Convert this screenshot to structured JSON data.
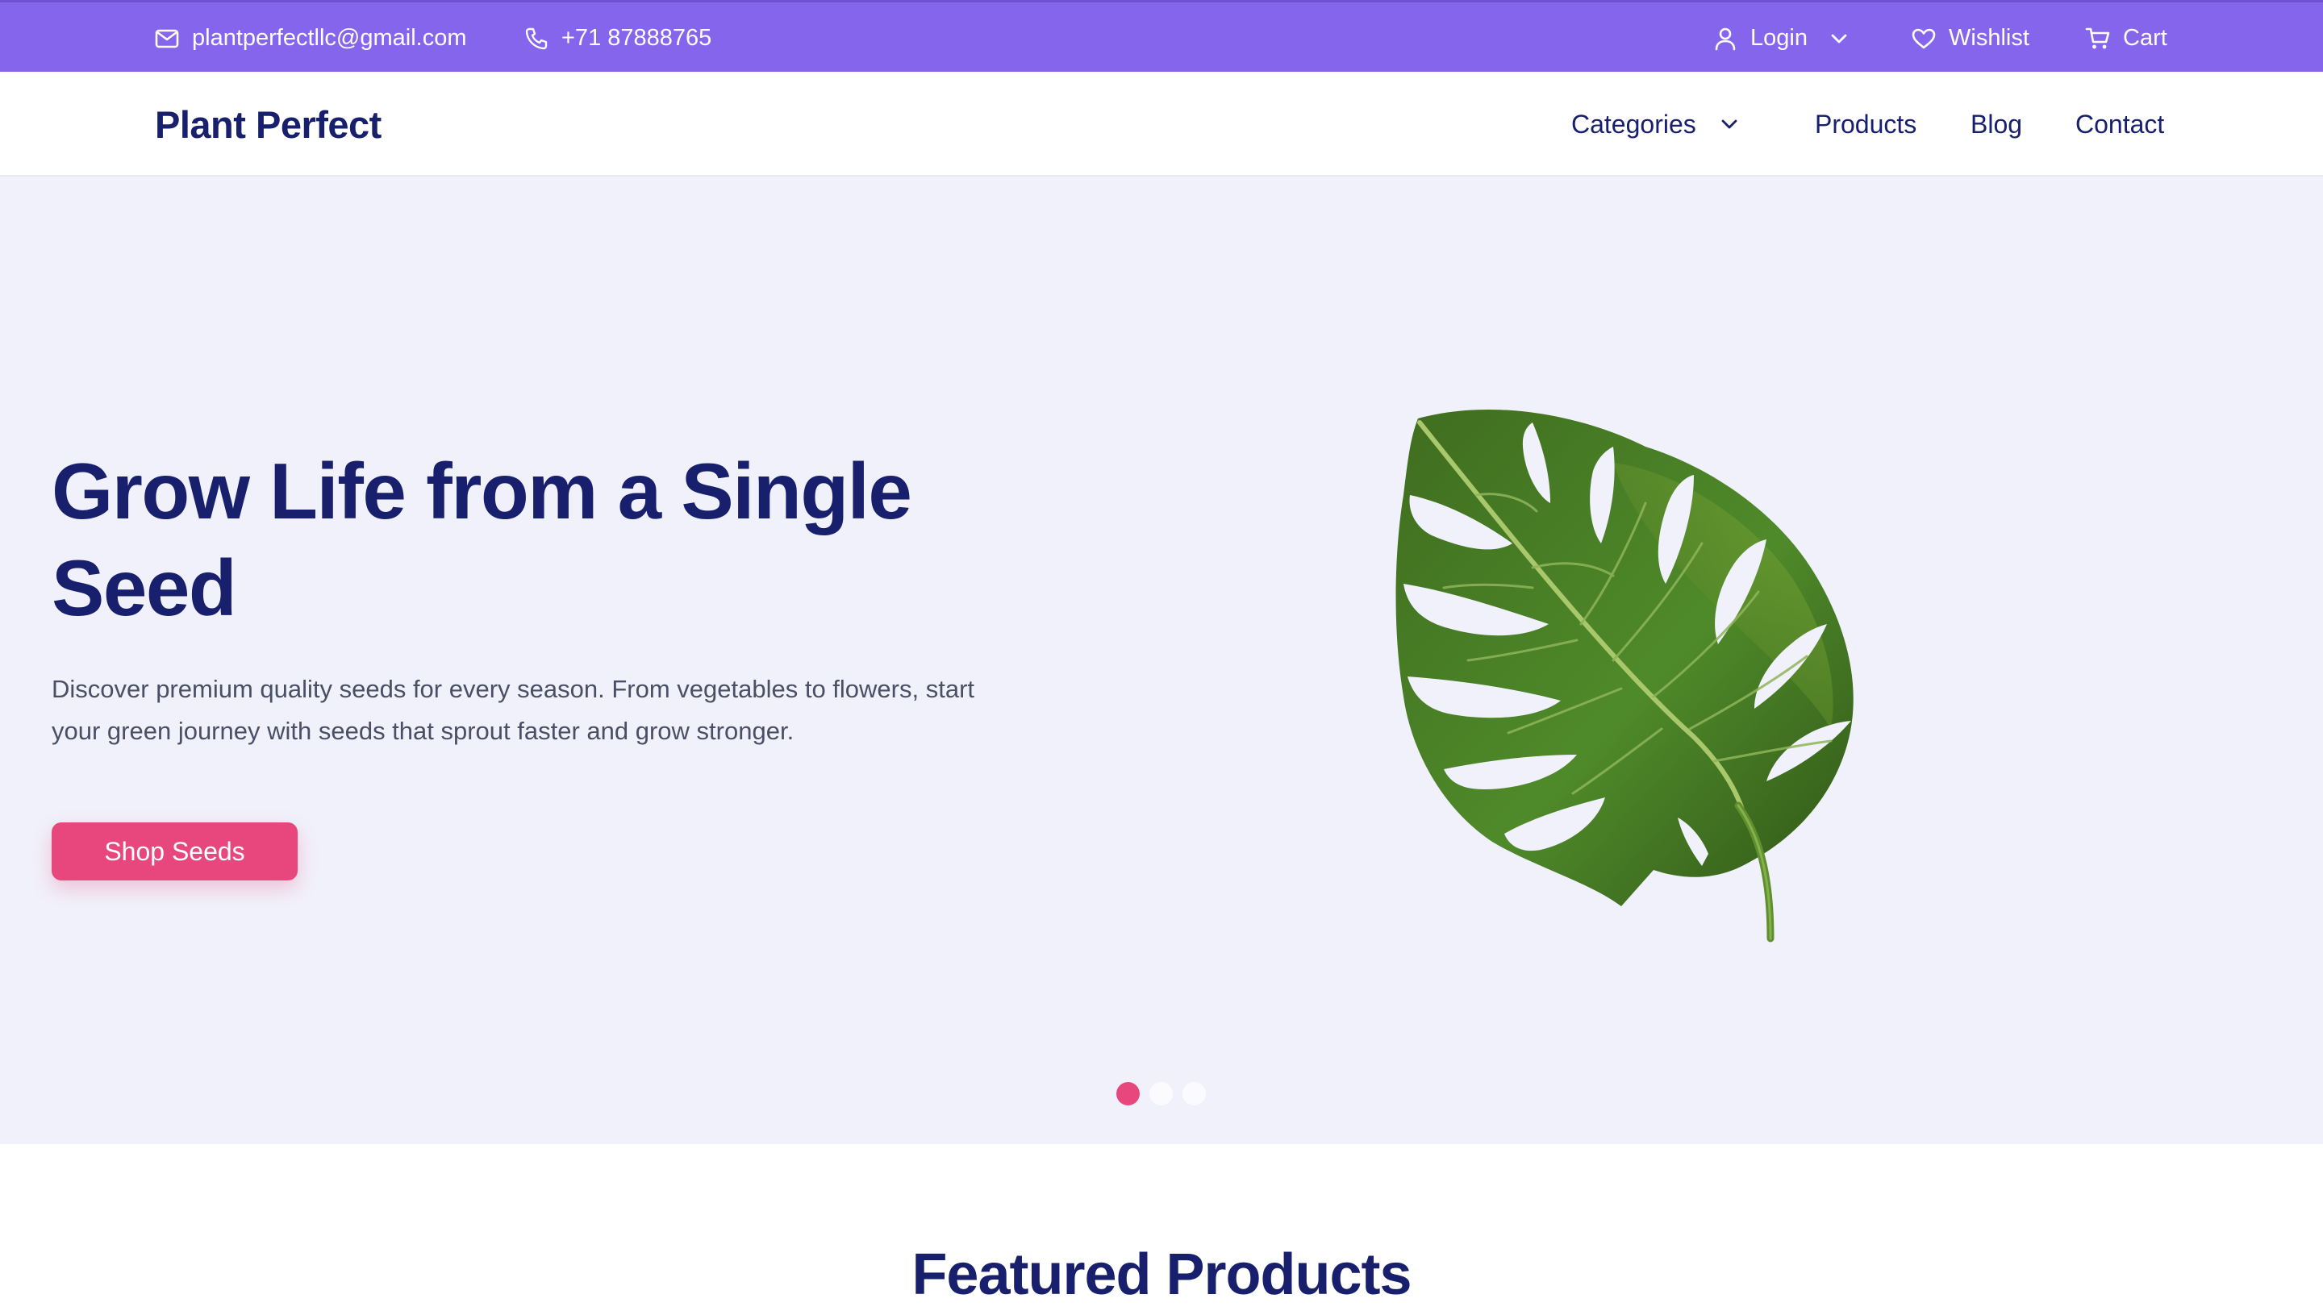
{
  "topbar": {
    "email": "plantperfectllc@gmail.com",
    "phone": "+71 87888765",
    "login_label": "Login",
    "wishlist_label": "Wishlist",
    "cart_label": "Cart",
    "icons": {
      "email": "mail-icon",
      "phone": "phone-icon",
      "login": "user-icon",
      "login_dropdown": "chevron-down-icon",
      "wishlist": "heart-icon",
      "cart": "cart-icon"
    }
  },
  "nav": {
    "brand": "Plant Perfect",
    "links": [
      "Categories",
      "Products",
      "Blog",
      "Contact"
    ]
  },
  "hero": {
    "title": "Grow Life from a Single Seed",
    "description": "Discover premium quality seeds for every season. From vegetables to flowers, start your green journey with seeds that sprout faster and grow stronger.",
    "cta_label": "Shop Seeds",
    "image": "monstera-leaf",
    "slides_total": 3,
    "active_slide": 1
  },
  "sections": {
    "featured_title": "Featured Products"
  },
  "colors": {
    "topbar": "#8565ec",
    "brand_text": "#18206e",
    "hero_background": "#f1f1fb",
    "accent": "#e8477e",
    "body_text": "#4a4f66"
  }
}
